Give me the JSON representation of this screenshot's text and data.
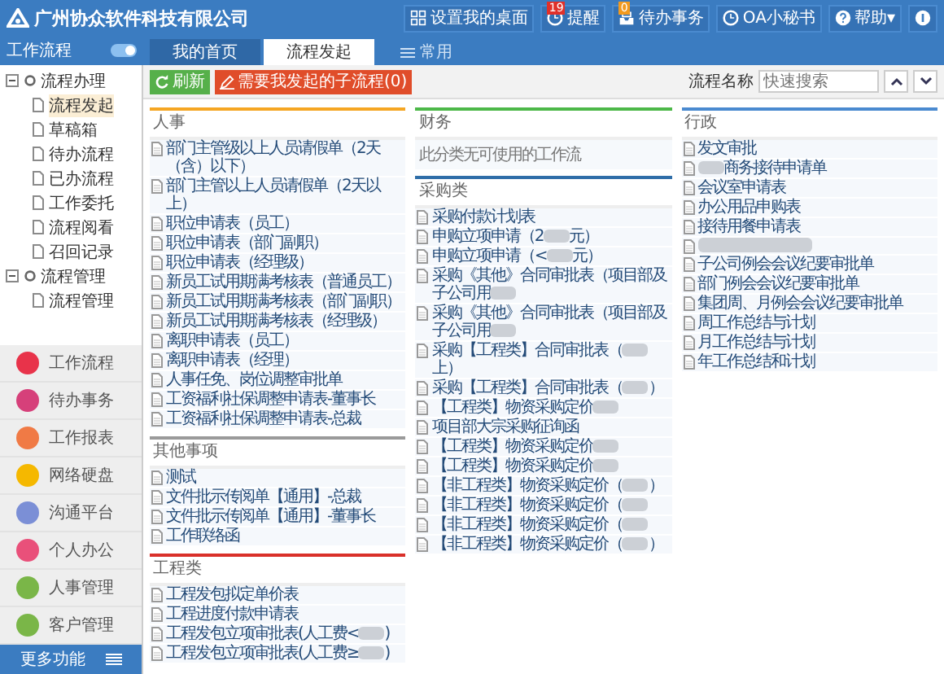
{
  "header": {
    "logo_text": "广州协众软件科技有限公司",
    "actions": [
      {
        "label": "设置我的桌面"
      },
      {
        "label": "提醒",
        "badge": "19"
      },
      {
        "label": "待办事务",
        "badge": "0"
      },
      {
        "label": "OA小秘书"
      },
      {
        "label": "帮助▾"
      },
      {
        "kind": "user"
      }
    ]
  },
  "sidebar": {
    "title": "工作流程",
    "toggle_on": true,
    "tree": [
      {
        "label": "流程办理",
        "expanded": true,
        "children": [
          {
            "label": "流程发起",
            "selected": true
          },
          {
            "label": "草稿箱",
            "selected": false
          },
          {
            "label": "待办流程",
            "selected": false
          },
          {
            "label": "已办流程",
            "selected": false
          },
          {
            "label": "工作委托",
            "selected": false
          },
          {
            "label": "流程阅看",
            "selected": false
          },
          {
            "label": "召回记录",
            "selected": false
          }
        ]
      },
      {
        "label": "流程管理",
        "expanded": true,
        "children": [
          {
            "label": "流程管理",
            "selected": false
          }
        ]
      }
    ],
    "nav": [
      {
        "label": "工作流程",
        "color": "#e8334a"
      },
      {
        "label": "待办事务",
        "color": "#d6407a"
      },
      {
        "label": "工作报表",
        "color": "#f07a45"
      },
      {
        "label": "网络硬盘",
        "color": "#f5b800"
      },
      {
        "label": "沟通平台",
        "color": "#7b8fd6"
      },
      {
        "label": "个人办公",
        "color": "#e9507a"
      },
      {
        "label": "人事管理",
        "color": "#7ab648"
      },
      {
        "label": "客户管理",
        "color": "#7ab648"
      }
    ],
    "more_button": "更多功能"
  },
  "tabs": [
    {
      "label": "我的首页",
      "selected": false
    },
    {
      "label": "流程发起",
      "selected": true
    },
    {
      "label": "常用",
      "selected": false
    }
  ],
  "toolbar": {
    "refresh": "刷新",
    "subflow": "需要我发起的子流程(0)",
    "search_label": "流程名称",
    "search_placeholder": "快速搜索"
  },
  "columns": [
    [
      {
        "title": "人事",
        "color": "#f5a623",
        "items": [
          {
            "label": "部门主管级以上人员请假单（2天（含）以下）",
            "kind": "plain"
          },
          {
            "label": "部门主管以上人员请假单（2天以上）",
            "kind": "plain"
          },
          {
            "label": "职位申请表（员工）",
            "kind": "plain"
          },
          {
            "label": "职位申请表（部门副职）",
            "kind": "plain"
          },
          {
            "label": "职位申请表（经理级）",
            "kind": "plain"
          },
          {
            "label": "新员工试用期满考核表（普通员工）",
            "kind": "plain"
          },
          {
            "label": "新员工试用期满考核表（部门副职）",
            "kind": "plain"
          },
          {
            "label": "新员工试用期满考核表（经理级）",
            "kind": "plain"
          },
          {
            "label": "离职申请表（员工）",
            "kind": "plain"
          },
          {
            "label": "离职申请表（经理）",
            "kind": "plain"
          },
          {
            "label": "人事任免、岗位调整审批单",
            "kind": "plain"
          },
          {
            "label": "工资福利社保调整申请表-董事长",
            "kind": "plain"
          },
          {
            "label": "工资福利社保调整申请表-总裁",
            "kind": "plain"
          }
        ]
      },
      {
        "title": "其他事项",
        "color": "#9a9a9a",
        "items": [
          {
            "label": "测试",
            "kind": "plain"
          },
          {
            "label": "文件批示传阅单【通用】-总裁",
            "kind": "plain"
          },
          {
            "label": "文件批示传阅单【通用】-董事长",
            "kind": "plain"
          },
          {
            "label": "工作联络函",
            "kind": "plain"
          }
        ]
      },
      {
        "title": "工程类",
        "color": "#d9302a",
        "items": [
          {
            "label": "工程发包拟定单价表",
            "kind": "plain"
          },
          {
            "label": "工程进度付款申请表",
            "kind": "plain"
          },
          {
            "label": "工程发包立项审批表(人工费<",
            "kind": "blurred_middle",
            "tail": ")"
          },
          {
            "label": "工程发包立项审批表(人工费≥",
            "kind": "blurred_middle",
            "tail": ")"
          }
        ]
      }
    ],
    [
      {
        "title": "财务",
        "color": "#4cb848",
        "empty_text": "此分类无可使用的工作流"
      },
      {
        "title": "采购类",
        "color": "#2f6ea8",
        "items": [
          {
            "label": "采购付款计划表",
            "kind": "plain"
          },
          {
            "label": "申购立项申请（2",
            "kind": "blurred_middle",
            "tail": "元）"
          },
          {
            "label": "申购立项申请（<",
            "kind": "blurred_middle",
            "tail": "元）"
          },
          {
            "label": "采购《其他》合同审批表（项目部及子公司用",
            "kind": "blurred_end"
          },
          {
            "label": "采购《其他》合同审批表（项目部及子公司用",
            "kind": "blurred_end"
          },
          {
            "label": "采购【工程类】合同审批表（",
            "kind": "blurred_middle",
            "tail": "上）"
          },
          {
            "label": "采购【工程类】合同审批表（",
            "kind": "blurred_middle",
            "tail": "）"
          },
          {
            "label": "【工程类】物资采购定价",
            "kind": "blurred_end"
          },
          {
            "label": "项目部大宗采购征询函",
            "kind": "plain"
          },
          {
            "label": "【工程类】物资采购定价",
            "kind": "blurred_end"
          },
          {
            "label": "【工程类】物资采购定价",
            "kind": "blurred_end"
          },
          {
            "label": "【非工程类】物资采购定价（",
            "kind": "blurred_middle",
            "tail": "）"
          },
          {
            "label": "【非工程类】物资采购定价（",
            "kind": "blurred_end"
          },
          {
            "label": "【非工程类】物资采购定价（",
            "kind": "blurred_end"
          },
          {
            "label": "【非工程类】物资采购定价（",
            "kind": "blurred_middle",
            "tail": "）"
          }
        ]
      }
    ],
    [
      {
        "title": "行政",
        "color": "#4a8ad0",
        "items": [
          {
            "label": "发文审批",
            "kind": "plain"
          },
          {
            "label": "商务接待申请单",
            "kind": "blurred_start"
          },
          {
            "label": "会议室申请表",
            "kind": "plain"
          },
          {
            "label": "办公用品申购表",
            "kind": "plain"
          },
          {
            "label": "接待用餐申请表",
            "kind": "plain"
          },
          {
            "kind": "blurred_all"
          },
          {
            "label": "子公司例会会议纪要审批单",
            "kind": "plain"
          },
          {
            "label": "部门例会会议纪要审批单",
            "kind": "plain"
          },
          {
            "label": "集团周、月例会会议纪要审批单",
            "kind": "plain"
          },
          {
            "label": "周工作总结与计划",
            "kind": "plain"
          },
          {
            "label": "月工作总结与计划",
            "kind": "plain"
          },
          {
            "label": "年工作总结和计划",
            "kind": "plain"
          }
        ]
      }
    ]
  ]
}
